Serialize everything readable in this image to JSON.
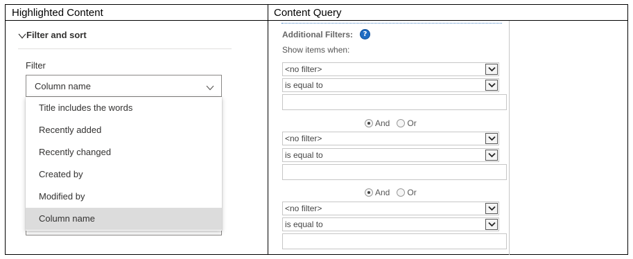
{
  "columns": {
    "left_header": "Highlighted Content",
    "right_header": "Content Query"
  },
  "highlighted_content": {
    "section_title": "Filter and sort",
    "filter_label": "Filter",
    "dropdown_value": "Column name",
    "menu_items": [
      "Title includes the words",
      "Recently added",
      "Recently changed",
      "Created by",
      "Modified by",
      "Column name"
    ],
    "selected_item": "Column name"
  },
  "content_query": {
    "additional_filters_label": "Additional Filters:",
    "help_icon": "?",
    "show_items_when": "Show items when:",
    "filters": [
      {
        "field": "<no filter>",
        "operator": "is equal to",
        "value": ""
      },
      {
        "field": "<no filter>",
        "operator": "is equal to",
        "value": ""
      },
      {
        "field": "<no filter>",
        "operator": "is equal to",
        "value": ""
      }
    ],
    "connectors": [
      {
        "and_label": "And",
        "or_label": "Or",
        "selected": "And"
      },
      {
        "and_label": "And",
        "or_label": "Or",
        "selected": "And"
      }
    ]
  }
}
